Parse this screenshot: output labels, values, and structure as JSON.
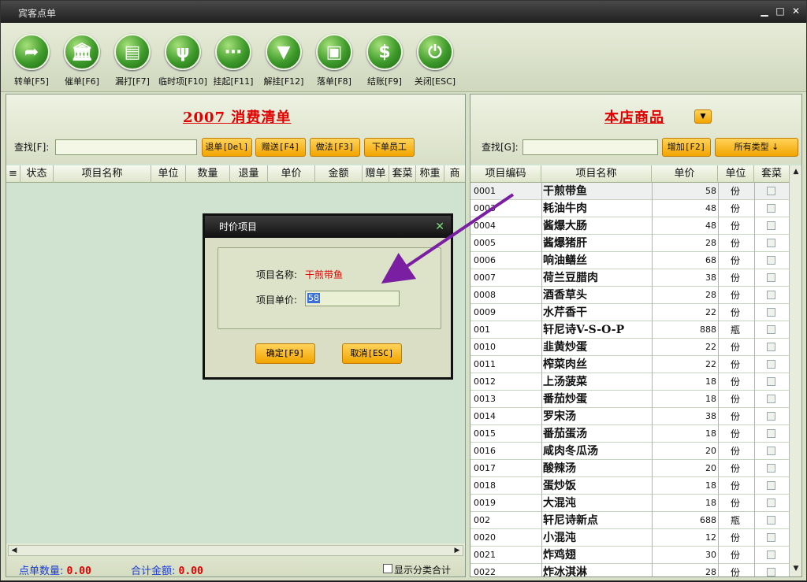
{
  "window": {
    "title": "宾客点单"
  },
  "toolbar": [
    {
      "label": "转单[F5]",
      "icon": "arrow-right-icon"
    },
    {
      "label": "催单[F6]",
      "icon": "building-icon"
    },
    {
      "label": "漏打[F7]",
      "icon": "document-icon"
    },
    {
      "label": "临时项[F10]",
      "icon": "fork-spoon-icon"
    },
    {
      "label": "挂起[F11]",
      "icon": "hang-icon"
    },
    {
      "label": "解挂[F12]",
      "icon": "tie-icon"
    },
    {
      "label": "落单[F8]",
      "icon": "monitor-icon"
    },
    {
      "label": "结账[F9]",
      "icon": "dollar-icon"
    },
    {
      "label": "关闭[ESC]",
      "icon": "power-icon"
    }
  ],
  "left": {
    "title": "2007 消费清单",
    "search_label": "查找[F]:",
    "buttons": [
      "退单[Del]",
      "赠送[F4]",
      "做法[F3]",
      "下单员工"
    ],
    "columns": [
      "≡",
      "状态",
      "项目名称",
      "单位",
      "数量",
      "退量",
      "单价",
      "金额",
      "赠单",
      "套菜",
      "称重",
      "商"
    ],
    "footer": {
      "count_label": "点单数量:",
      "count_value": "0.00",
      "total_label": "合计金额:",
      "total_value": "0.00",
      "show_category": "显示分类合计"
    }
  },
  "right": {
    "title": "本店商品",
    "search_label": "查找[G]:",
    "add_button": "增加[F2]",
    "type_button": "所有类型 ↓",
    "columns": [
      "项目编码",
      "项目名称",
      "单价",
      "单位",
      "套菜"
    ],
    "rows": [
      {
        "code": "0001",
        "name": "干煎带鱼",
        "price": "58",
        "unit": "份"
      },
      {
        "code": "0003",
        "name": "耗油牛肉",
        "price": "48",
        "unit": "份"
      },
      {
        "code": "0004",
        "name": "酱爆大肠",
        "price": "48",
        "unit": "份"
      },
      {
        "code": "0005",
        "name": "酱爆猪肝",
        "price": "28",
        "unit": "份"
      },
      {
        "code": "0006",
        "name": "响油鳝丝",
        "price": "68",
        "unit": "份"
      },
      {
        "code": "0007",
        "name": "荷兰豆腊肉",
        "price": "38",
        "unit": "份"
      },
      {
        "code": "0008",
        "name": "酒香草头",
        "price": "28",
        "unit": "份"
      },
      {
        "code": "0009",
        "name": "水芹香干",
        "price": "22",
        "unit": "份"
      },
      {
        "code": "001",
        "name": "轩尼诗V-S-O-P",
        "price": "888",
        "unit": "瓶"
      },
      {
        "code": "0010",
        "name": "韭黄炒蛋",
        "price": "22",
        "unit": "份"
      },
      {
        "code": "0011",
        "name": "榨菜肉丝",
        "price": "22",
        "unit": "份"
      },
      {
        "code": "0012",
        "name": "上汤菠菜",
        "price": "18",
        "unit": "份"
      },
      {
        "code": "0013",
        "name": "番茄炒蛋",
        "price": "18",
        "unit": "份"
      },
      {
        "code": "0014",
        "name": "罗宋汤",
        "price": "38",
        "unit": "份"
      },
      {
        "code": "0015",
        "name": "番茄蛋汤",
        "price": "18",
        "unit": "份"
      },
      {
        "code": "0016",
        "name": "咸肉冬瓜汤",
        "price": "20",
        "unit": "份"
      },
      {
        "code": "0017",
        "name": "酸辣汤",
        "price": "20",
        "unit": "份"
      },
      {
        "code": "0018",
        "name": "蛋炒饭",
        "price": "18",
        "unit": "份"
      },
      {
        "code": "0019",
        "name": "大混沌",
        "price": "18",
        "unit": "份"
      },
      {
        "code": "002",
        "name": "轩尼诗新点",
        "price": "688",
        "unit": "瓶"
      },
      {
        "code": "0020",
        "name": "小混沌",
        "price": "12",
        "unit": "份"
      },
      {
        "code": "0021",
        "name": "炸鸡翅",
        "price": "30",
        "unit": "份"
      },
      {
        "code": "0022",
        "name": "炸冰淇淋",
        "price": "28",
        "unit": "份"
      }
    ]
  },
  "dialog": {
    "title": "时价项目",
    "name_label": "项目名称:",
    "name_value": "干煎带鱼",
    "price_label": "项目单价:",
    "price_value": "58",
    "ok": "确定[F9]",
    "cancel": "取消[ESC]"
  },
  "colors": {
    "accent": "#f2a400",
    "title_red": "#e00000",
    "annotation_arrow": "#7a1fa2"
  }
}
